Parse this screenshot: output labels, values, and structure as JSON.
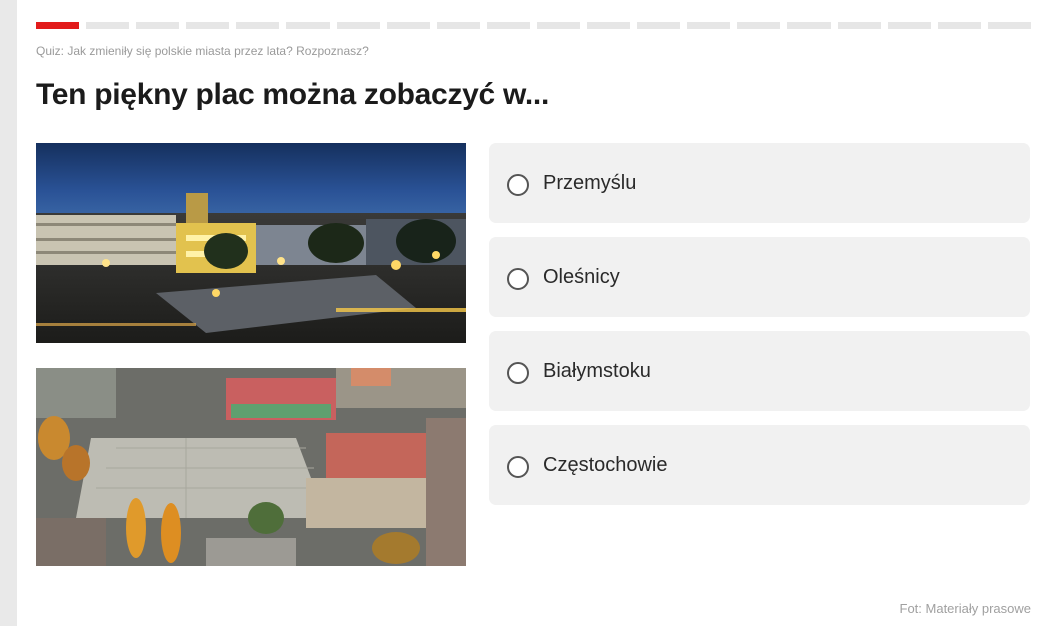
{
  "quiz": {
    "subtitle": "Quiz: Jak zmieniły się polskie miasta przez lata? Rozpoznasz?",
    "question": "Ten piękny plac można zobaczyć w...",
    "progress": {
      "current": 1,
      "total": 20
    },
    "answers": [
      {
        "label": "Przemyślu"
      },
      {
        "label": "Oleśnicy"
      },
      {
        "label": "Białymstoku"
      },
      {
        "label": "Częstochowie"
      }
    ],
    "photo_credit": "Fot: Materiały prasowe"
  },
  "colors": {
    "accent": "#e21b1b",
    "option_bg": "#f1f1f1"
  }
}
